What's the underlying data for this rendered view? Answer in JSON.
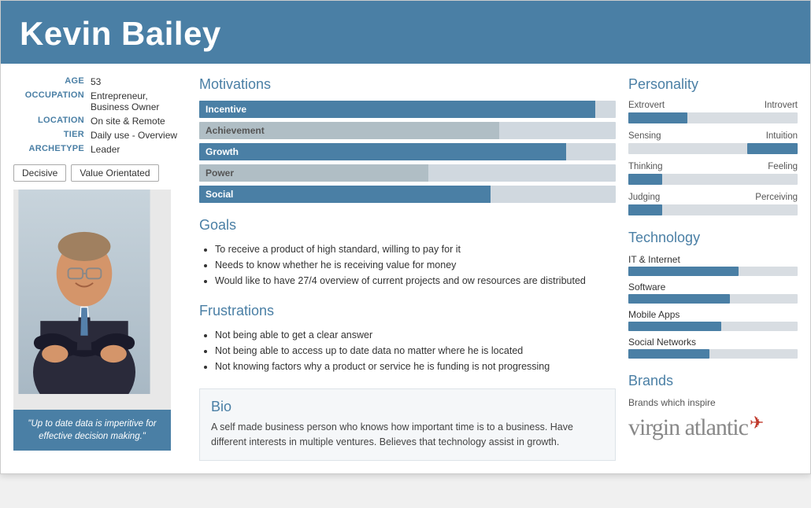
{
  "header": {
    "name": "Kevin Bailey"
  },
  "profile": {
    "age_label": "AGE",
    "age_value": "53",
    "occupation_label": "OCCUPATION",
    "occupation_value": "Entrepreneur, Business Owner",
    "location_label": "LOCATION",
    "location_value": "On site & Remote",
    "tier_label": "TIER",
    "tier_value": "Daily use - Overview",
    "archetype_label": "ARCHETYPE",
    "archetype_value": "Leader"
  },
  "badges": [
    "Decisive",
    "Value Orientated"
  ],
  "quote": "\"Up to date data is imperitive for effective decision making.\"",
  "motivations": {
    "title": "Motivations",
    "items": [
      {
        "label": "Incentive",
        "fill_pct": 95,
        "filled": true
      },
      {
        "label": "Achievement",
        "fill_pct": 72,
        "filled": false
      },
      {
        "label": "Growth",
        "fill_pct": 88,
        "filled": true
      },
      {
        "label": "Power",
        "fill_pct": 55,
        "filled": false
      },
      {
        "label": "Social",
        "fill_pct": 70,
        "filled": true
      }
    ]
  },
  "goals": {
    "title": "Goals",
    "items": [
      "To receive a product of high standard, willing to pay for it",
      "Needs to know whether he is receiving value for money",
      "Would like to have 27/4 overview of current projects and ow resources are distributed"
    ]
  },
  "frustrations": {
    "title": "Frustrations",
    "items": [
      "Not being able to get a clear answer",
      "Not being able to access up to date data no matter where he is located",
      "Not knowing factors why a product or service he is funding is not progressing"
    ]
  },
  "bio": {
    "title": "Bio",
    "text": "A self made business person who knows how important time is to a business. Have different interests in multiple ventures. Believes that technology assist in growth."
  },
  "personality": {
    "title": "Personality",
    "traits": [
      {
        "left": "Extrovert",
        "right": "Introvert",
        "side": "left",
        "pct": 35
      },
      {
        "left": "Sensing",
        "right": "Intuition",
        "side": "right",
        "pct": 30
      },
      {
        "left": "Thinking",
        "right": "Feeling",
        "side": "left",
        "pct": 20
      },
      {
        "left": "Judging",
        "right": "Perceiving",
        "side": "left",
        "pct": 20
      }
    ]
  },
  "technology": {
    "title": "Technology",
    "items": [
      {
        "label": "IT & Internet",
        "fill_pct": 65
      },
      {
        "label": "Software",
        "fill_pct": 60
      },
      {
        "label": "Mobile Apps",
        "fill_pct": 55
      },
      {
        "label": "Social Networks",
        "fill_pct": 48
      }
    ]
  },
  "brands": {
    "title": "Brands",
    "subtitle": "Brands which inspire",
    "logo_text": "virgin atlantic"
  }
}
